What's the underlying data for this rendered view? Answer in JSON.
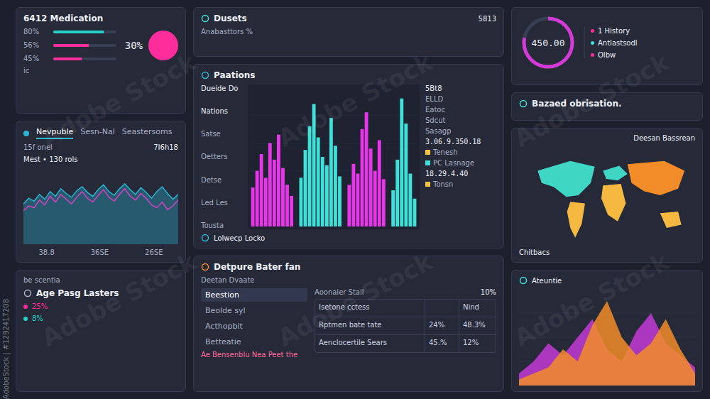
{
  "watermark": {
    "marks": [
      "Adobe Stock",
      "Adobe Stock",
      "Adobe Stock",
      "Adobe Stock",
      "Adobe Stock",
      "Adobe Stock"
    ],
    "stock_id": "AdobeStock | #1292417208"
  },
  "medication": {
    "title": "6412 Medication",
    "cut_label": "ic",
    "rows": [
      {
        "label": "80%",
        "level": 0.8,
        "color": "#22d3c5"
      },
      {
        "label": "56%",
        "level": 0.56,
        "color": "#ff2d9b"
      },
      {
        "label": "45%",
        "level": 0.45,
        "color": "#ff2d9b"
      }
    ],
    "pie": {
      "label": "30%",
      "color": "#ff2d9b"
    }
  },
  "trend": {
    "tabs": [
      {
        "label": "Nevpuble",
        "selected": true
      },
      {
        "label": "Sesn-Nal",
        "selected": false
      },
      {
        "label": "Seastersoms",
        "selected": false
      }
    ],
    "stat": "7I6h18",
    "subtitle": "15f onel",
    "legend": "Mest • 130 rols",
    "series": [
      {
        "color": "#2bb8d6",
        "values": [
          42,
          48,
          45,
          52,
          47,
          55,
          50,
          58,
          53,
          49,
          56,
          60,
          54,
          50,
          57,
          62,
          55,
          51,
          58,
          63,
          57,
          52,
          59,
          54,
          48,
          55,
          60,
          53,
          47,
          52
        ]
      },
      {
        "color": "#e040c8",
        "values": [
          35,
          40,
          38,
          46,
          41,
          50,
          44,
          52,
          47,
          42,
          49,
          55,
          48,
          44,
          51,
          57,
          49,
          45,
          52,
          58,
          50,
          46,
          53,
          48,
          41,
          38,
          44,
          36,
          40,
          46
        ]
      }
    ],
    "ticks": [
      "38.8",
      "36SE",
      "26SE"
    ]
  },
  "age": {
    "cut_title": "be scentia",
    "title": "Age Pasg Lasters",
    "values": [
      {
        "label": "25%",
        "color": "#ff2d9b"
      },
      {
        "label": "8%",
        "color": "#22d3c5"
      }
    ]
  },
  "header": {
    "title": "Dusets",
    "value": "5813",
    "subtitle": "Anabasttors %"
  },
  "chart": {
    "title": "Paations",
    "captions": [
      "Dueide Do",
      "Nations"
    ],
    "y_labels": [
      "Satse",
      "Oetters",
      "Detse",
      "Led Les",
      "Tousta"
    ],
    "series": [
      {
        "color": "#e536e8",
        "values": [
          28,
          40,
          52,
          35,
          60,
          48,
          66,
          42,
          30,
          22
        ]
      },
      {
        "color": "#3fe0d8",
        "values": [
          35,
          55,
          72,
          88,
          64,
          50,
          44,
          78,
          58,
          36
        ]
      },
      {
        "color": "#e536e8",
        "values": [
          30,
          45,
          38,
          70,
          82,
          56,
          40,
          62,
          34
        ]
      },
      {
        "color": "#3fe0d8",
        "values": [
          26,
          48,
          92,
          74,
          38,
          20
        ]
      }
    ],
    "side_top": "5Bt8",
    "side_items": [
      "ELLD",
      "Eatoc",
      "Sdcut",
      "Sasagp"
    ],
    "big1": "3.06.9.350.18",
    "legend1": [
      {
        "label": "Tenesh",
        "color": "#f5c542"
      },
      {
        "label": "PC Lasnage",
        "color": "#3fe0d8"
      }
    ],
    "big2": "18.29.4.40",
    "legend2": [
      {
        "label": "Tonsn",
        "color": "#f5c542"
      }
    ],
    "footer": "Lolwecp Locko"
  },
  "gauge": {
    "value": "450.00",
    "level": 0.78,
    "list": [
      "1 History",
      "Antlastsodl",
      "Olbw"
    ]
  },
  "notice": {
    "title": "Bazaed obrisation."
  },
  "map": {
    "title": "Deesan Bassrean",
    "label": "Chitbacs",
    "regions": [
      {
        "color": "#3fd6c4"
      },
      {
        "color": "#f5b942"
      },
      {
        "color": "#3fd6c4"
      },
      {
        "color": "#f28c28"
      },
      {
        "color": "#f5b942"
      }
    ]
  },
  "table_panel": {
    "title": "Detpure Bater fan",
    "subtitle": "Deetan Dvaate",
    "menu": [
      {
        "label": "Beestion",
        "selected": true
      },
      {
        "label": "Beolde syl",
        "selected": false
      },
      {
        "label": "Acthopbit",
        "selected": false
      },
      {
        "label": "Betteatie",
        "selected": false
      }
    ],
    "note": "Ae Bensenblu Nea Peet the",
    "top_value": "10%",
    "side_note": "Aoonaier Stall",
    "rows": [
      [
        "Isetone cctess",
        "",
        "Nind"
      ],
      [
        "Rptmen bate tate",
        "24%",
        "48.3%"
      ],
      [
        "Aenclocertile Sears",
        "45.%",
        "12%"
      ]
    ]
  },
  "area": {
    "title": "Ateuntie",
    "series": [
      {
        "color": "#c23ad6",
        "values": [
          10,
          20,
          35,
          25,
          40,
          55,
          30,
          20,
          45,
          60,
          35,
          25,
          15
        ]
      },
      {
        "color": "#f28c28",
        "values": [
          5,
          10,
          15,
          30,
          20,
          50,
          70,
          40,
          25,
          35,
          55,
          30,
          10
        ]
      }
    ]
  }
}
